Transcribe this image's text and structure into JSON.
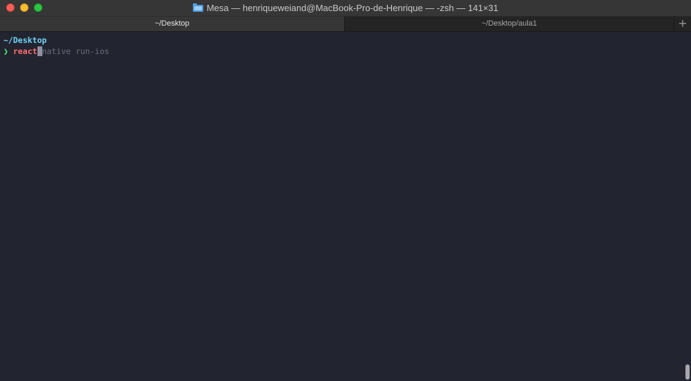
{
  "window": {
    "title": "Mesa — henriqueweiand@MacBook-Pro-de-Henrique — -zsh — 141×31",
    "title_icon": "folder-icon"
  },
  "traffic_lights": {
    "close_color": "#fd5f57",
    "minimize_color": "#febb2e",
    "zoom_color": "#28c840"
  },
  "tabs": [
    {
      "label": "~/Desktop",
      "active": true
    },
    {
      "label": "~/Desktop/aula1",
      "active": false
    }
  ],
  "new_tab": {
    "label": "+"
  },
  "terminal": {
    "cwd": "~/Desktop",
    "prompt_symbol": "❯",
    "typed_command": "react",
    "suggestion": "native run-ios",
    "colors": {
      "background": "#222430",
      "cwd": "#6fd3f5",
      "prompt": "#50fa7b",
      "typed": "#ff6e6e",
      "suggestion": "#6b6d7d"
    }
  }
}
